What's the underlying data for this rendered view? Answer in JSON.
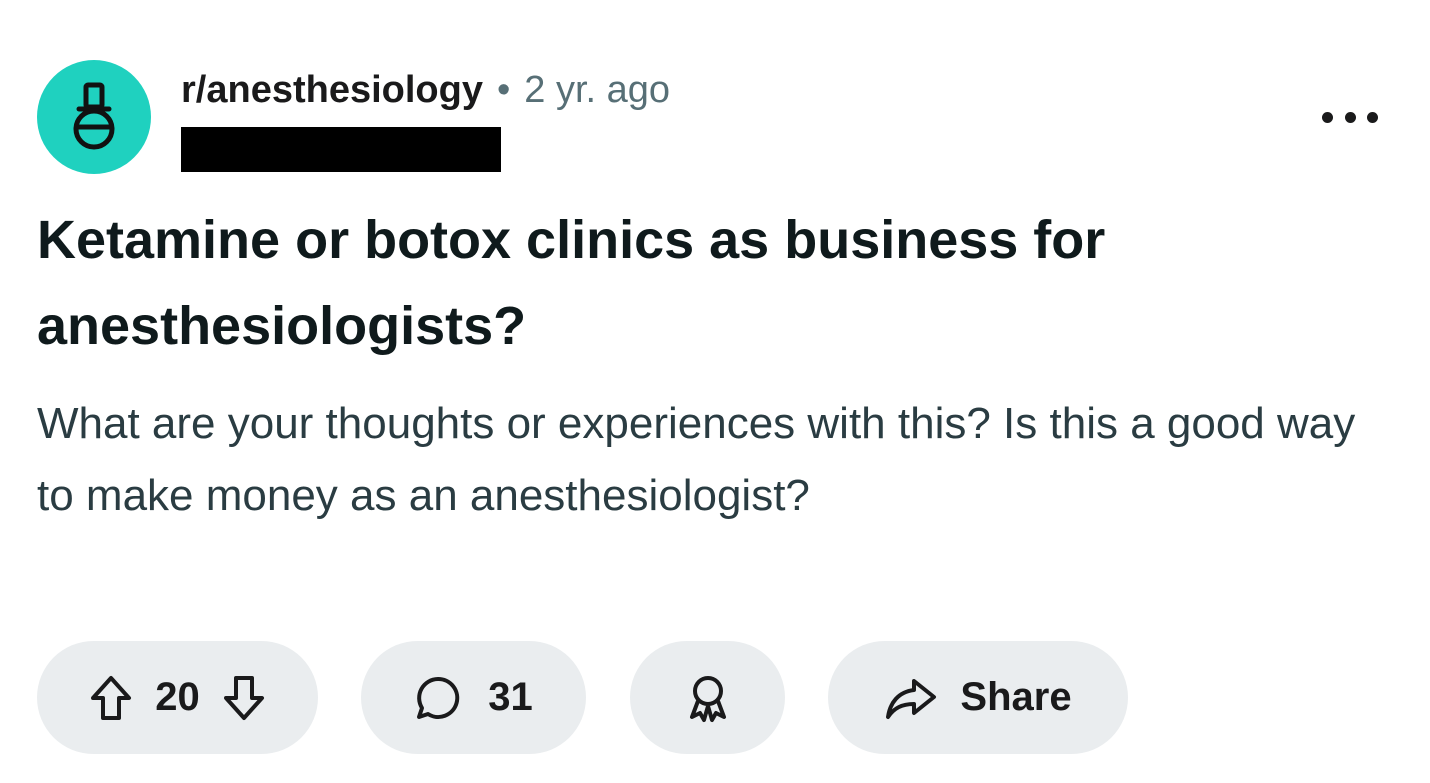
{
  "post": {
    "subreddit": "r/anesthesiology",
    "separator": "•",
    "age": "2 yr. ago",
    "title": "Ketamine or botox clinics as business for anesthesiologists?",
    "body": "What are your thoughts or experiences with this? Is this a good way to make money as an anesthesiologist?"
  },
  "actions": {
    "upvote_count": "20",
    "comment_count": "31",
    "share_label": "Share"
  },
  "icons": {
    "avatar": "subreddit-avatar-icon",
    "more": "more-options-icon",
    "upvote": "upvote-arrow-icon",
    "downvote": "downvote-arrow-icon",
    "comment": "comment-bubble-icon",
    "award": "award-ribbon-icon",
    "share": "share-arrow-icon"
  },
  "colors": {
    "avatar_bg": "#1fd1bf",
    "action_bg": "#eaedef",
    "meta_text": "#576f76",
    "redaction": "#000000"
  }
}
